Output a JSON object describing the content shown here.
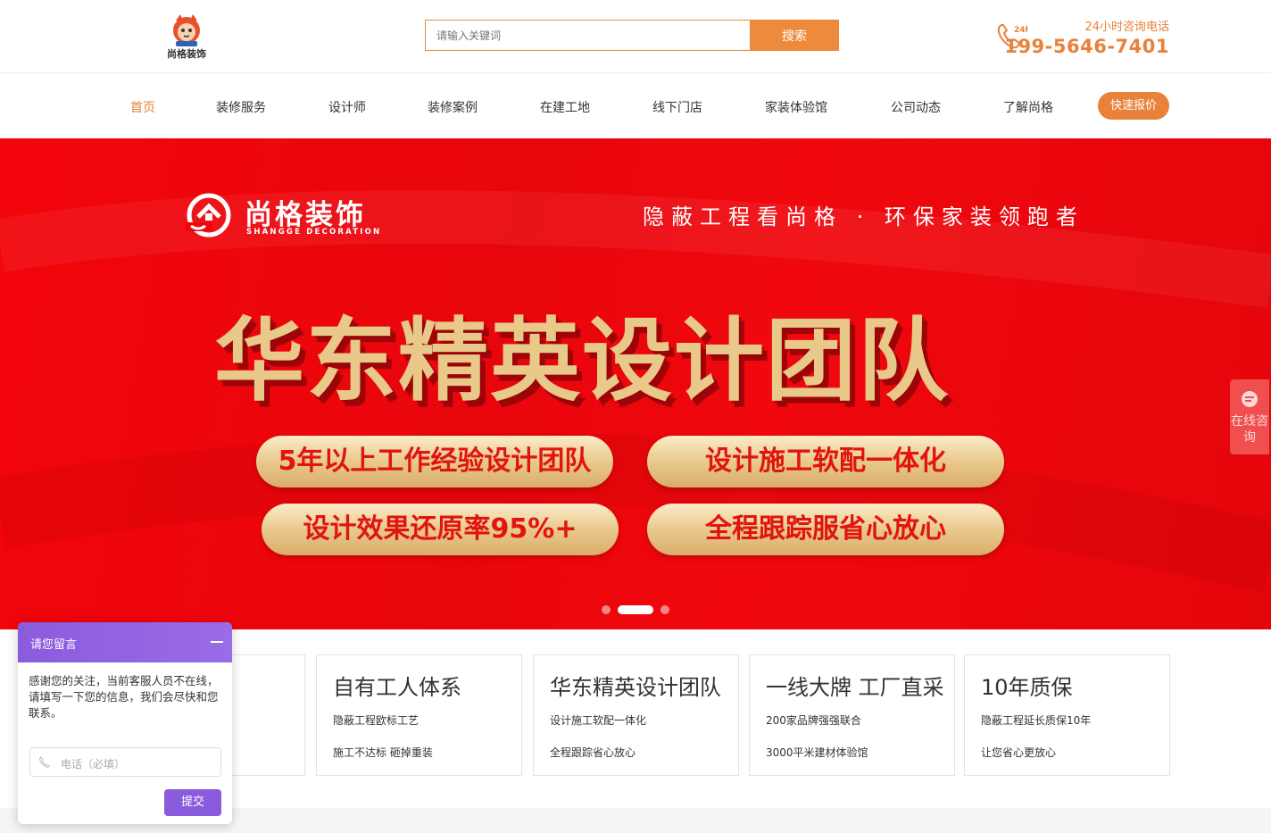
{
  "header": {
    "logo_text": "尚格装饰",
    "search": {
      "placeholder": "请输入关键词",
      "button_label": "搜索"
    },
    "hotline": {
      "badge": "24h",
      "label": "24小时咨询电话",
      "number": "199-5646-7401"
    }
  },
  "nav": {
    "items": [
      {
        "label": "首页",
        "active": true
      },
      {
        "label": "装修服务"
      },
      {
        "label": "设计师"
      },
      {
        "label": "装修案例"
      },
      {
        "label": "在建工地"
      },
      {
        "label": "线下门店"
      },
      {
        "label": "家装体验馆"
      },
      {
        "label": "公司动态"
      },
      {
        "label": "了解尚格"
      }
    ],
    "quote_button": "快速报价"
  },
  "banner": {
    "brand_cn": "尚格装饰",
    "brand_en": "SHANGGE DECORATION",
    "slogan": "隐蔽工程看尚格 · 环保家装领跑者",
    "headline": "华东精英设计团队",
    "pills": [
      "5年以上工作经验设计团队",
      "设计施工软配一体化",
      "设计效果还原率95%+",
      "全程跟踪服省心放心"
    ],
    "slides": {
      "count": 3,
      "active": 2
    }
  },
  "consult": {
    "label": "在线咨询"
  },
  "features": [
    {
      "title": "",
      "line1": "",
      "line2": ""
    },
    {
      "title": "自有工人体系",
      "line1": "隐蔽工程欧标工艺",
      "line2": "施工不达标 砸掉重装"
    },
    {
      "title": "华东精英设计团队",
      "line1": "设计施工软配一体化",
      "line2": "全程跟踪省心放心"
    },
    {
      "title": "一线大牌 工厂直采",
      "line1": "200家品牌强强联合",
      "line2": "3000平米建材体验馆"
    },
    {
      "title": "10年质保",
      "line1": "隐蔽工程延长质保10年",
      "line2": "让您省心更放心"
    }
  ],
  "chat": {
    "title": "请您留言",
    "message": "感谢您的关注，当前客服人员不在线，请填写一下您的信息，我们会尽快和您联系。",
    "phone_placeholder": "电话（必填）",
    "submit_label": "提交"
  },
  "colors": {
    "accent": "#e8813a",
    "banner_red": "#ee060c",
    "chat_purple": "#8a5bdc"
  }
}
